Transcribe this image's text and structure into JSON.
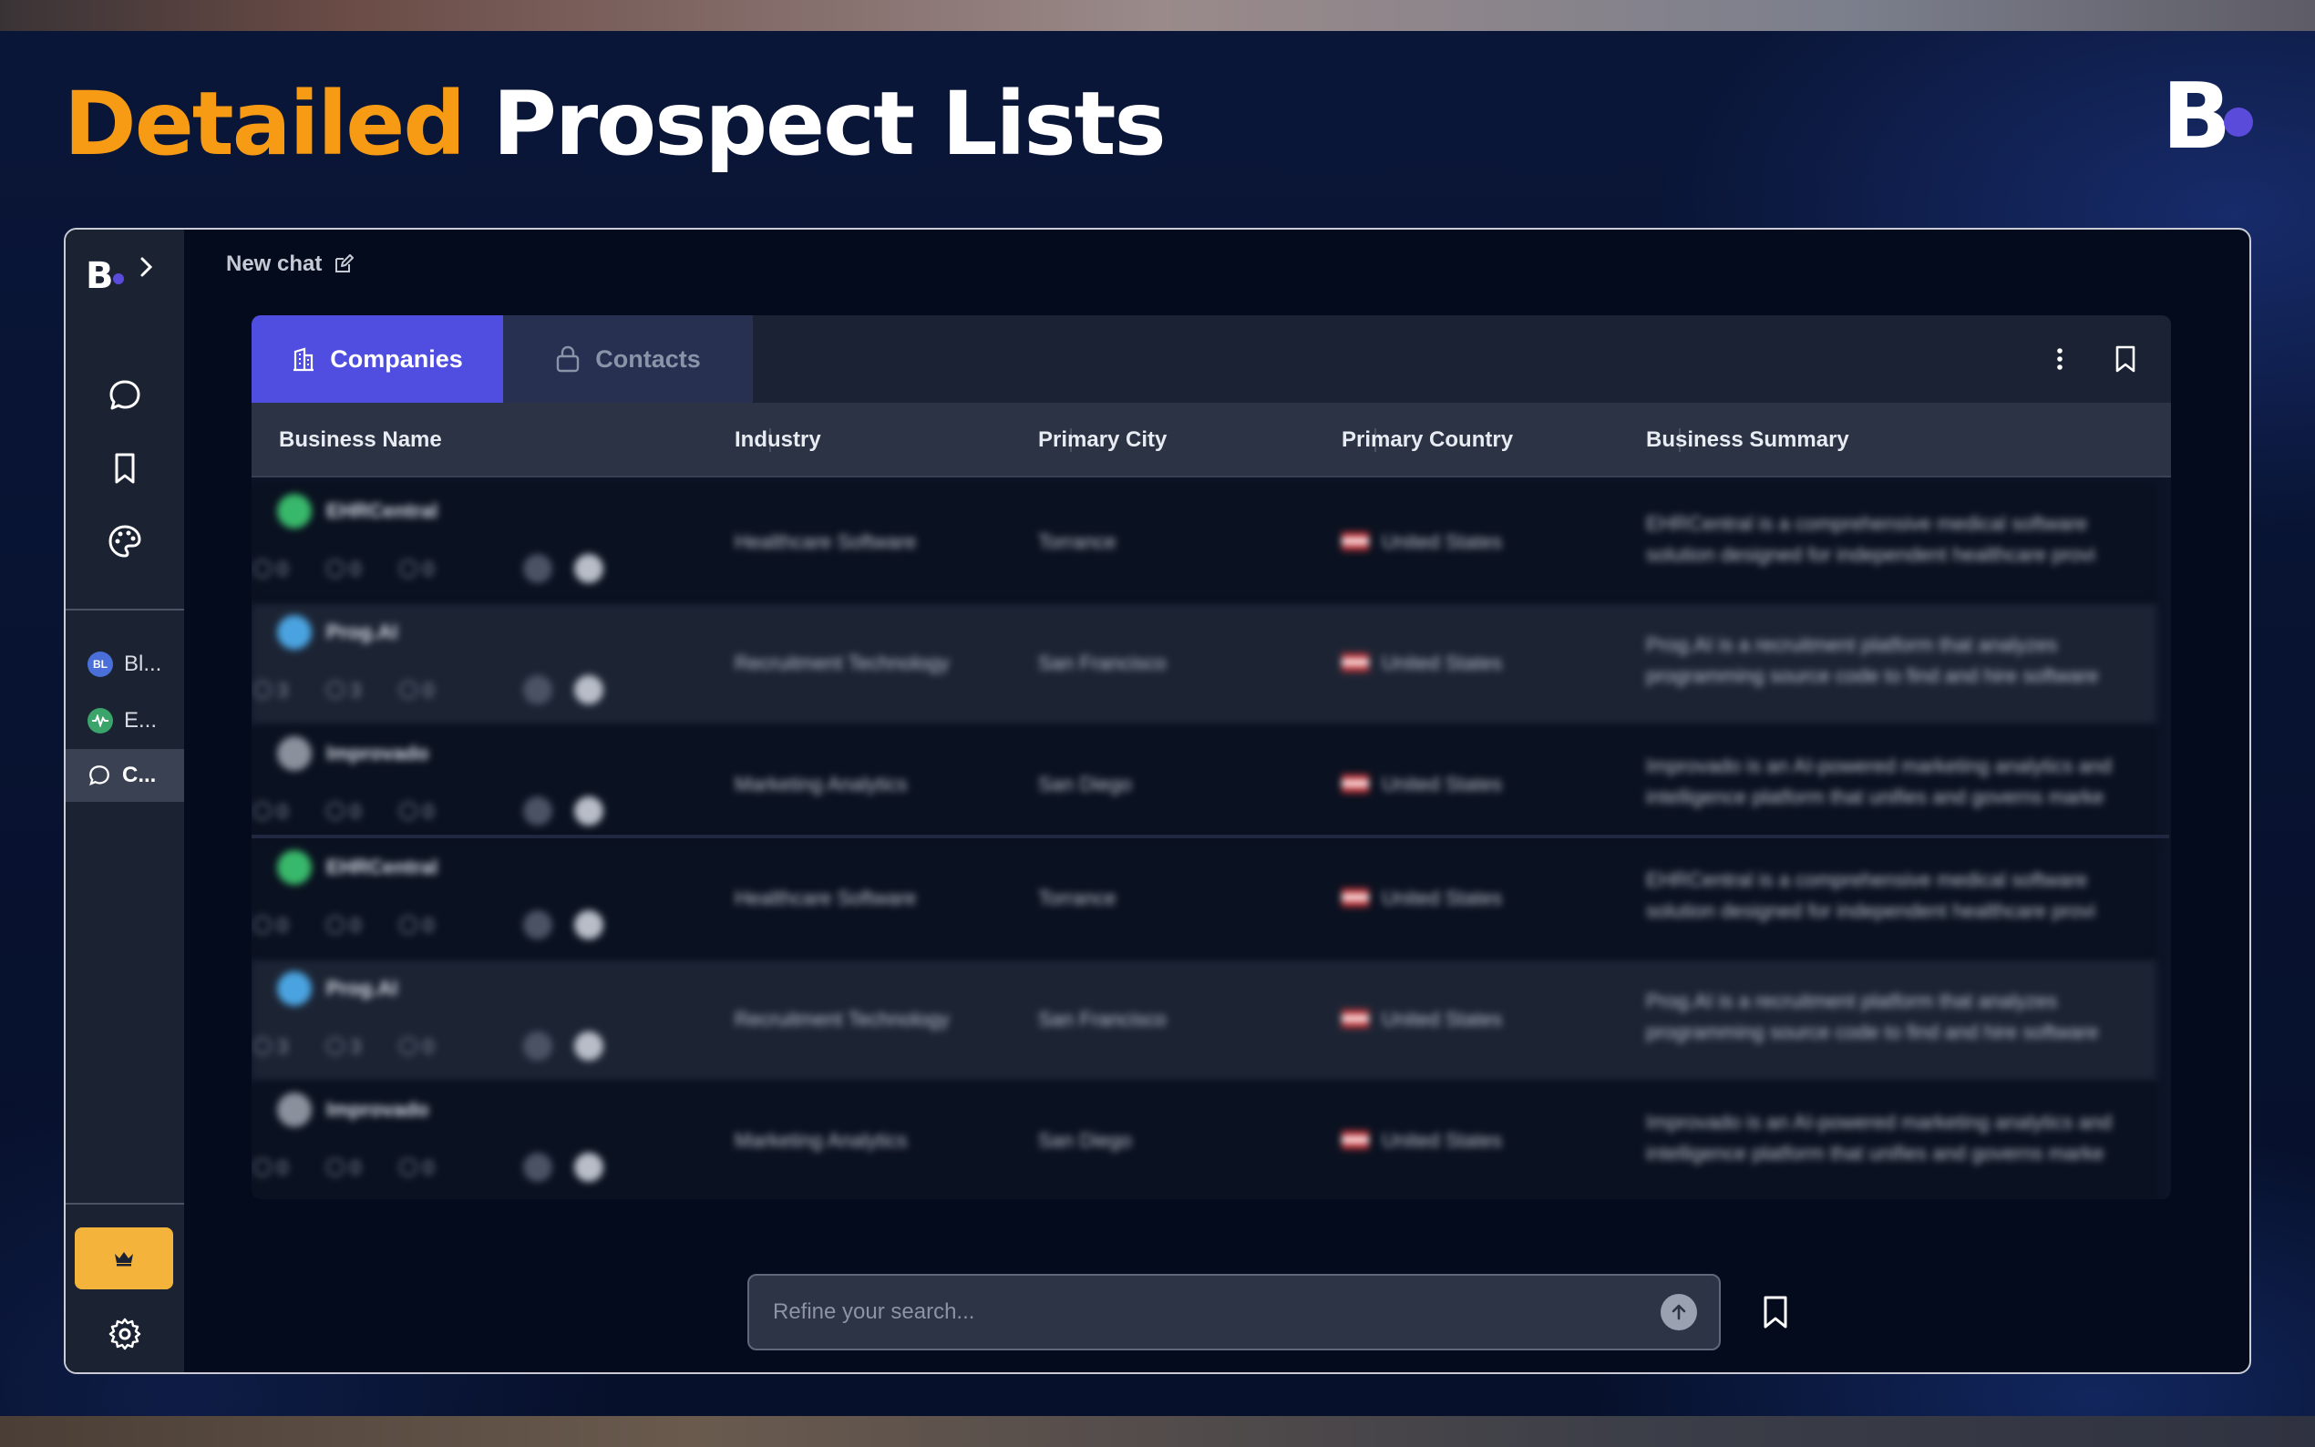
{
  "slide": {
    "title_accent": "Detailed",
    "title_rest": "Prospect Lists",
    "brand_logo": "B"
  },
  "sidebar": {
    "logo": "B",
    "chats": [
      {
        "label": "Bl...",
        "badge": "BL",
        "color": "#4a6fd8"
      },
      {
        "label": "E...",
        "badge": "",
        "color": "#3aa46a"
      },
      {
        "label": "C...",
        "badge": "",
        "color": ""
      }
    ]
  },
  "header": {
    "new_chat_label": "New chat"
  },
  "tabs": [
    {
      "label": "Companies",
      "active": true
    },
    {
      "label": "Contacts",
      "active": false,
      "locked": true
    }
  ],
  "table": {
    "columns": [
      "Business Name",
      "Industry",
      "Primary City",
      "Primary Country",
      "Business Summary"
    ],
    "rows": [
      {
        "name": "EHRCentral",
        "industry": "Healthcare Software",
        "city": "Torrance",
        "country": "United States",
        "summary": "EHRCentral is a comprehensive medical software solution designed for independent healthcare provi",
        "stats": [
          "0",
          "0",
          "0"
        ],
        "avatar_color": "#38b86a"
      },
      {
        "name": "Prog.AI",
        "industry": "Recruitment Technology",
        "city": "San Francisco",
        "country": "United States",
        "summary": "Prog.AI is a recruitment platform that analyzes programming source code to find and hire software",
        "stats": [
          "3",
          "3",
          "0"
        ],
        "avatar_color": "#4aa3e0"
      },
      {
        "name": "Improvado",
        "industry": "Marketing Analytics",
        "city": "San Diego",
        "country": "United States",
        "summary": "Improvado is an AI-powered marketing analytics and intelligence platform that unifies and governs marke",
        "stats": [
          "0",
          "0",
          "0"
        ],
        "avatar_color": "#8a909c"
      },
      {
        "name": "EHRCentral",
        "industry": "Healthcare Software",
        "city": "Torrance",
        "country": "United States",
        "summary": "EHRCentral is a comprehensive medical software solution designed for independent healthcare provi",
        "stats": [
          "0",
          "0",
          "0"
        ],
        "avatar_color": "#38b86a"
      },
      {
        "name": "Prog.AI",
        "industry": "Recruitment Technology",
        "city": "San Francisco",
        "country": "United States",
        "summary": "Prog.AI is a recruitment platform that analyzes programming source code to find and hire software",
        "stats": [
          "3",
          "3",
          "0"
        ],
        "avatar_color": "#4aa3e0"
      },
      {
        "name": "Improvado",
        "industry": "Marketing Analytics",
        "city": "San Diego",
        "country": "United States",
        "summary": "Improvado is an AI-powered marketing analytics and intelligence platform that unifies and governs marke",
        "stats": [
          "0",
          "0",
          "0"
        ],
        "avatar_color": "#8a909c"
      }
    ]
  },
  "search": {
    "placeholder": "Refine your search..."
  },
  "colors": {
    "accent": "#f79b14",
    "primary": "#4f4ee0",
    "upgrade": "#f4b43c"
  }
}
